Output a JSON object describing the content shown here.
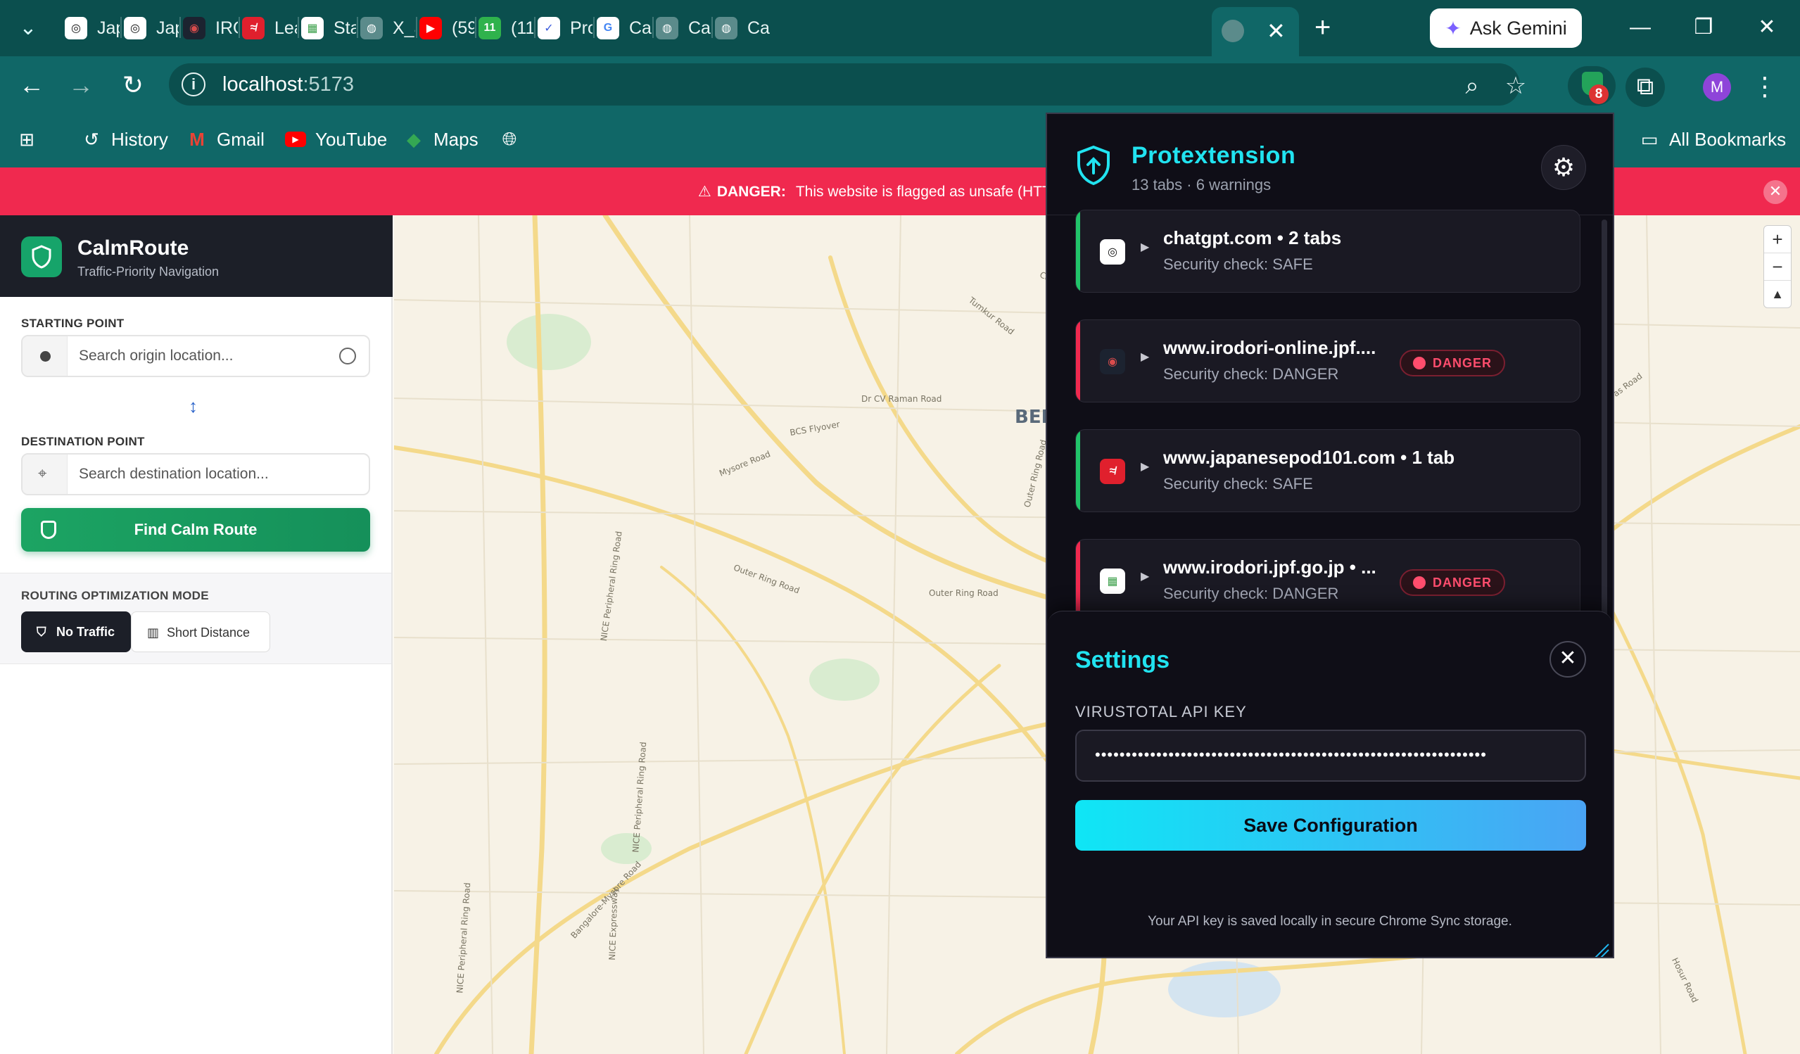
{
  "browser": {
    "tabs": [
      {
        "label": "Japa",
        "fav_text": "◎",
        "fav_bg": "#ffffff",
        "fav_fg": "#111111"
      },
      {
        "label": "Japa",
        "fav_text": "◎",
        "fav_bg": "#ffffff",
        "fav_fg": "#111111"
      },
      {
        "label": "IROI",
        "fav_text": "◉",
        "fav_bg": "#1c2330",
        "fav_fg": "#d84c4c"
      },
      {
        "label": "Lear",
        "fav_text": "≉",
        "fav_bg": "#e0202d",
        "fav_fg": "#ffffff"
      },
      {
        "label": "Start",
        "fav_text": "▦",
        "fav_bg": "#ffffff",
        "fav_fg": "#3b9f4a"
      },
      {
        "label": "X_al",
        "fav_text": "◍",
        "fav_bg": "#5b8b8b",
        "fav_fg": "#ffffff"
      },
      {
        "label": "(59)",
        "fav_text": "▶",
        "fav_bg": "#ff0000",
        "fav_fg": "#ffffff"
      },
      {
        "label": "(11)",
        "fav_text": "11",
        "fav_bg": "#2fb24c",
        "fav_fg": "#ffffff"
      },
      {
        "label": "Proj",
        "fav_text": "✓",
        "fav_bg": "#ffffff",
        "fav_fg": "#3b5bdb"
      },
      {
        "label": "Caln",
        "fav_text": "G",
        "fav_bg": "#ffffff",
        "fav_fg": "#4285f4"
      },
      {
        "label": "Caln",
        "fav_text": "◍",
        "fav_bg": "#5b8b8b",
        "fav_fg": "#ffffff"
      },
      {
        "label": "Caln",
        "fav_text": "◍",
        "fav_bg": "#5b8b8b",
        "fav_fg": "#ffffff"
      }
    ],
    "active_tab_close": "✕",
    "new_tab": "+",
    "ask_gemini": "Ask Gemini",
    "url_host": "localhost",
    "url_port": ":5173",
    "extension_badge": "8",
    "profile_initial": "M",
    "bookmarks": {
      "history": "History",
      "gmail": "Gmail",
      "youtube": "YouTube",
      "maps": "Maps",
      "all_bookmarks": "All Bookmarks"
    }
  },
  "banner": {
    "prefix": "DANGER:",
    "text": "This website is flagged as unsafe (HTTP (no",
    "color": "#f0294f"
  },
  "app": {
    "title": "CalmRoute",
    "subtitle": "Traffic-Priority Navigation",
    "starting_label": "STARTING POINT",
    "origin_placeholder": "Search origin location...",
    "destination_label": "DESTINATION POINT",
    "destination_placeholder": "Search destination location...",
    "find_button": "Find Calm Route",
    "mode_label": "ROUTING OPTIMIZATION MODE",
    "mode_no_traffic": "No Traffic",
    "mode_short_distance": "Short Distance",
    "accent": "#16a46a"
  },
  "map": {
    "labels": [
      "Coraguntepalya Flyover",
      "Tumkur Road",
      "Outer Ring Road",
      "Tumkur Road",
      "Dr CV Raman Road",
      "Outer Ring Road",
      "NICE Peripheral Ring Road",
      "NICE Peripheral Ring Road",
      "BEN",
      "BCS Flyover",
      "Mysore Road",
      "Outer Ring Road",
      "NICE Expressway",
      "Bangalore-Mysore Road",
      "NICE Peripheral Ring Road",
      "Outer Ring Road",
      "Old Madras Road",
      "Outer Ring Road",
      "Hosur Road"
    ],
    "zoom_in": "+",
    "zoom_out": "−",
    "compass": "▲"
  },
  "extension": {
    "title": "Protextension",
    "summary": "13 tabs · 6 warnings",
    "accent": "#21e3f0",
    "cards": [
      {
        "name": "chatgpt.com • 2 tabs",
        "status": "Security check: SAFE",
        "level": "safe",
        "pill": "",
        "fav_text": "◎",
        "fav_bg": "#ffffff",
        "fav_fg": "#111111"
      },
      {
        "name": "www.irodori-online.jpf....",
        "status": "Security check: DANGER",
        "level": "danger",
        "pill": "DANGER",
        "fav_text": "◉",
        "fav_bg": "#1c2330",
        "fav_fg": "#d84c4c"
      },
      {
        "name": "www.japanesepod101.com • 1 tab",
        "status": "Security check: SAFE",
        "level": "safe",
        "pill": "",
        "fav_text": "≉",
        "fav_bg": "#e0202d",
        "fav_fg": "#ffffff"
      },
      {
        "name": "www.irodori.jpf.go.jp • ...",
        "status": "Security check: DANGER",
        "level": "danger",
        "pill": "DANGER",
        "fav_text": "▦",
        "fav_bg": "#ffffff",
        "fav_fg": "#3b9f4a"
      }
    ],
    "settings": {
      "title": "Settings",
      "api_label": "VIRUSTOTAL API KEY",
      "api_value": "••••••••••••••••••••••••••••••••••••••••••••••••••••••••••••••••",
      "save": "Save Configuration",
      "note": "Your API key is saved locally in secure Chrome Sync storage."
    }
  }
}
